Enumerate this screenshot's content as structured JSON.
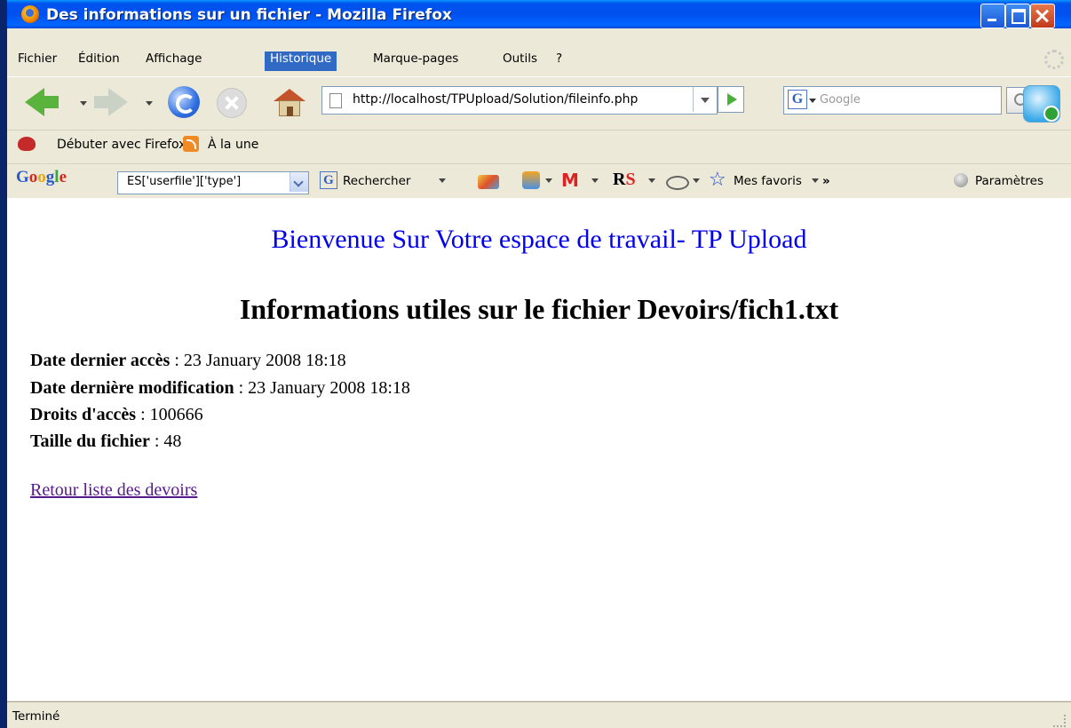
{
  "window": {
    "title": "Des informations sur un fichier - Mozilla Firefox"
  },
  "menu": {
    "items": [
      {
        "label": "Fichier"
      },
      {
        "label": "Édition"
      },
      {
        "label": "Affichage"
      },
      {
        "label": "Historique",
        "active": true
      },
      {
        "label": "Marque-pages"
      },
      {
        "label": "Outils"
      },
      {
        "label": "?"
      }
    ]
  },
  "nav": {
    "url": "http://localhost/TPUpload/Solution/fileinfo.php",
    "search_placeholder": "Google"
  },
  "bookmarks": {
    "items": [
      {
        "label": "Débuter avec Firefox",
        "icon": "firefox-bookmark-icon"
      },
      {
        "label": "À la une",
        "icon": "rss-feed-icon"
      }
    ]
  },
  "google_toolbar": {
    "logo": "Google",
    "query": "ES['userfile']['type']",
    "search_label": "Rechercher",
    "rs_label": "RS",
    "favorites_label": "Mes favoris",
    "more_label": "»",
    "settings_label": "Paramètres"
  },
  "page": {
    "welcome": "Bienvenue Sur Votre espace de travail- TP Upload",
    "heading": "Informations utiles sur le fichier Devoirs/fich1.txt",
    "info": [
      {
        "label": "Date dernier accès",
        "value": " : 23 January 2008 18:18"
      },
      {
        "label": "Date dernière modification",
        "value": " : 23 January 2008 18:18"
      },
      {
        "label": "Droits d'accès",
        "value": " : 100666"
      },
      {
        "label": "Taille du fichier",
        "value": " : 48"
      }
    ],
    "back_link": "Retour liste des devoirs"
  },
  "status": {
    "text": "Terminé"
  },
  "colors": {
    "title_bar": "#0054e3",
    "link": "#0000ee",
    "visited_link": "#551a8b",
    "menu_active": "#316ac5"
  }
}
